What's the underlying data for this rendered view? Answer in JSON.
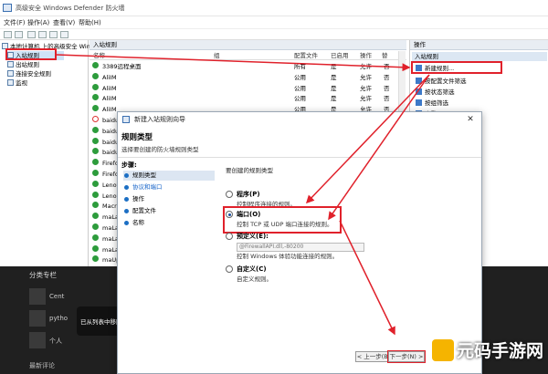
{
  "window": {
    "title": "高级安全 Windows Defender 防火墙",
    "menu": [
      "文件(F)",
      "操作(A)",
      "查看(V)",
      "帮助(H)"
    ]
  },
  "tree": {
    "root": "本地计算机 上的高级安全 Windows ...",
    "items": [
      "入站规则",
      "出站规则",
      "连接安全规则",
      "监视"
    ]
  },
  "center": {
    "header": "入站规则",
    "columns": [
      "名称",
      "组",
      "配置文件",
      "已启用",
      "操作",
      "替"
    ],
    "rows": [
      {
        "name": "3389远程桌面",
        "icon": "ok",
        "profile": "所有",
        "enabled": "是",
        "action": "允许",
        "override": "否"
      },
      {
        "name": "AliIM",
        "icon": "ok",
        "profile": "公用",
        "enabled": "是",
        "action": "允许",
        "override": "否"
      },
      {
        "name": "AliIM",
        "icon": "ok",
        "profile": "公用",
        "enabled": "是",
        "action": "允许",
        "override": "否"
      },
      {
        "name": "AliIM",
        "icon": "ok",
        "profile": "公用",
        "enabled": "是",
        "action": "允许",
        "override": "否"
      },
      {
        "name": "AliIM",
        "icon": "ok",
        "profile": "公用",
        "enabled": "是",
        "action": "允许",
        "override": "否"
      },
      {
        "name": "baidunetdiskho",
        "icon": "no",
        "profile": "",
        "enabled": "",
        "action": "",
        "override": ""
      },
      {
        "name": "baidunetdiskho",
        "icon": "ok",
        "profile": "",
        "enabled": "",
        "action": "",
        "override": ""
      },
      {
        "name": "baidunetdiskho",
        "icon": "ok",
        "profile": "",
        "enabled": "",
        "action": "",
        "override": ""
      },
      {
        "name": "baidunetdiskho",
        "icon": "ok",
        "profile": "",
        "enabled": "",
        "action": "",
        "override": ""
      },
      {
        "name": "Firefox (C:\\Pro",
        "icon": "ok",
        "profile": "",
        "enabled": "",
        "action": "",
        "override": ""
      },
      {
        "name": "Firefox (C:\\Pro",
        "icon": "ok",
        "profile": "",
        "enabled": "",
        "action": "",
        "override": ""
      },
      {
        "name": "Lenovo Lsf",
        "icon": "ok",
        "profile": "",
        "enabled": "",
        "action": "",
        "override": ""
      },
      {
        "name": "Lenovo Lsf",
        "icon": "ok",
        "profile": "",
        "enabled": "",
        "action": "",
        "override": ""
      },
      {
        "name": "MacroRecorde",
        "icon": "ok",
        "profile": "",
        "enabled": "",
        "action": "",
        "override": ""
      },
      {
        "name": "maLauncher",
        "icon": "ok",
        "profile": "",
        "enabled": "",
        "action": "",
        "override": ""
      },
      {
        "name": "maLauncher",
        "icon": "ok",
        "profile": "",
        "enabled": "",
        "action": "",
        "override": ""
      },
      {
        "name": "maLauncher",
        "icon": "ok",
        "profile": "",
        "enabled": "",
        "action": "",
        "override": ""
      },
      {
        "name": "maLauncher",
        "icon": "ok",
        "profile": "",
        "enabled": "",
        "action": "",
        "override": ""
      },
      {
        "name": "maUpdat",
        "icon": "ok",
        "profile": "",
        "enabled": "",
        "action": "",
        "override": ""
      }
    ]
  },
  "actions": {
    "header": "操作",
    "section": "入站规则",
    "items": [
      "新建规则...",
      "按配置文件筛选",
      "按状态筛选",
      "按组筛选",
      "查看"
    ]
  },
  "wizard": {
    "title": "新建入站规则向导",
    "heading": "规则类型",
    "subheading": "选择要创建的防火墙规则类型",
    "steps_title": "步骤:",
    "steps": [
      "规则类型",
      "协议和端口",
      "操作",
      "配置文件",
      "名称"
    ],
    "question": "要创建的规则类型",
    "options": [
      {
        "label": "程序(P)",
        "desc": "控制程序连接的规则。",
        "selected": false
      },
      {
        "label": "端口(O)",
        "desc": "控制 TCP 或 UDP 端口连接的规则。",
        "selected": true
      },
      {
        "label": "预定义(E):",
        "desc": "控制 Windows 体验功能连接的规则。",
        "selected": false
      },
      {
        "label": "自定义(C)",
        "desc": "自定义规则。",
        "selected": false
      }
    ],
    "predef_value": "@FirewallAPI.dll,-80200",
    "buttons": [
      "< 上一步(B)",
      "下一步(N) >"
    ]
  },
  "background": {
    "category": "分类专栏",
    "items": [
      "Cent",
      "pytho",
      "个人"
    ],
    "toast": "已从列表中移除\"Fi",
    "footer": "最新评论"
  },
  "watermark": "元码手游网",
  "colors": {
    "annotation_red": "#e0212b",
    "ok_green": "#2d9c3c"
  }
}
